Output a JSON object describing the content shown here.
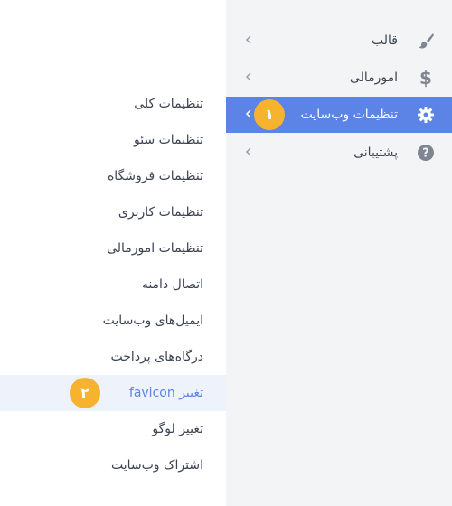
{
  "main_menu": {
    "items": [
      {
        "label": "قالب",
        "icon": "brush-icon"
      },
      {
        "label": "امورمالی",
        "icon": "dollar-icon"
      },
      {
        "label": "تنظیمات وب‌سایت",
        "icon": "gear-icon",
        "active": true,
        "badge": "۱"
      },
      {
        "label": "پشتیبانی",
        "icon": "question-circle-icon"
      }
    ]
  },
  "sub_menu": {
    "items": [
      {
        "label": "تنظیمات کلی"
      },
      {
        "label": "تنظیمات سئو"
      },
      {
        "label": "تنظیمات فروشگاه"
      },
      {
        "label": "تنظیمات کاربری"
      },
      {
        "label": "تنظیمات امورمالی"
      },
      {
        "label": "اتصال دامنه"
      },
      {
        "label": "ایمیل‌های وب‌سایت"
      },
      {
        "label": "درگاه‌های پرداخت"
      },
      {
        "label": "تغییر favicon",
        "highlight": true,
        "badge": "۲"
      },
      {
        "label": "تغییر لوگو"
      },
      {
        "label": "اشتراک وب‌سایت"
      }
    ]
  },
  "colors": {
    "active_bg": "#5c84e6",
    "badge": "#f7b32e",
    "sidebar_bg": "#f3f4f6",
    "highlight_bg": "#eef2fb"
  }
}
